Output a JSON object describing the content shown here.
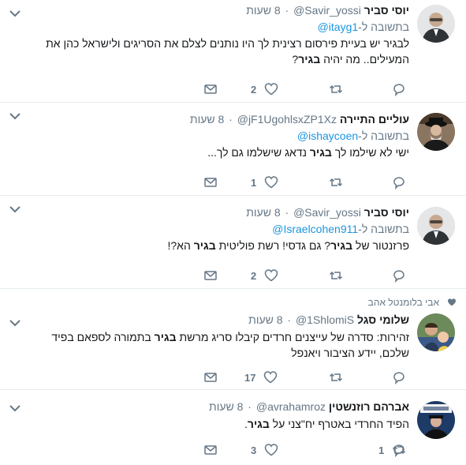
{
  "colors": {
    "accent": "#1b95e0",
    "muted": "#657786",
    "text": "#14171a",
    "divider": "#e6ecf0"
  },
  "icons": {
    "dropdown": "chevron-down-icon",
    "reply": "reply-icon",
    "retweet": "retweet-icon",
    "like": "heart-icon",
    "share": "envelope-icon"
  },
  "tweets": [
    {
      "name": "יוסי סביר",
      "handle": "@Savir_yossi",
      "time": "8 שעות",
      "reply_prefix": "בתשובה ל-",
      "reply_to": "@itayg1",
      "text_parts": [
        "לבגיר יש בעיית פירסום רצינית לך היו נותנים לצלם את הסריגים ולישראל כהן את המעילים.. מה יהיה ",
        "בגיר",
        "?"
      ],
      "likes": "2"
    },
    {
      "name": "עוליים התיירה",
      "handle": "@jF1UgohlsxZP1Xz",
      "time": "8 שעות",
      "reply_prefix": "בתשובה ל-",
      "reply_to": "@ishaycoen",
      "text_parts": [
        "ישי לא שילמו לך ",
        "בגיר",
        " נדאג שישלמו גם לך..."
      ],
      "likes": "1"
    },
    {
      "name": "יוסי סביר",
      "handle": "@Savir_yossi",
      "time": "8 שעות",
      "reply_prefix": "בתשובה ל-",
      "reply_to": "@Israelcohen911",
      "text_parts": [
        "פרזנטור של ",
        "בגיר",
        "? גם גדסי! רשת פוליטית ",
        "בגיר",
        " הא?!"
      ],
      "likes": "2"
    },
    {
      "liked_by": "אבי בלומנטל אהב",
      "name": "שלומי סגל",
      "handle": "@1ShlomiS",
      "time": "8 שעות",
      "text_parts": [
        "זהירות: סדרה של עייצנים חרדים קיבלו סריג מרשת ",
        "בגיר",
        " בתמורה לספאם בפיד שלכם, יידע הציבור ויאנפל"
      ],
      "likes": "17"
    },
    {
      "name": "אברהם רוזנשטין",
      "handle": "@avrahamroz",
      "time": "8 שעות",
      "text_parts": [
        "הפיד החרדי באטרף יח\"צני על ",
        "בגיר",
        "."
      ],
      "likes": "1",
      "retweets": "3"
    }
  ]
}
